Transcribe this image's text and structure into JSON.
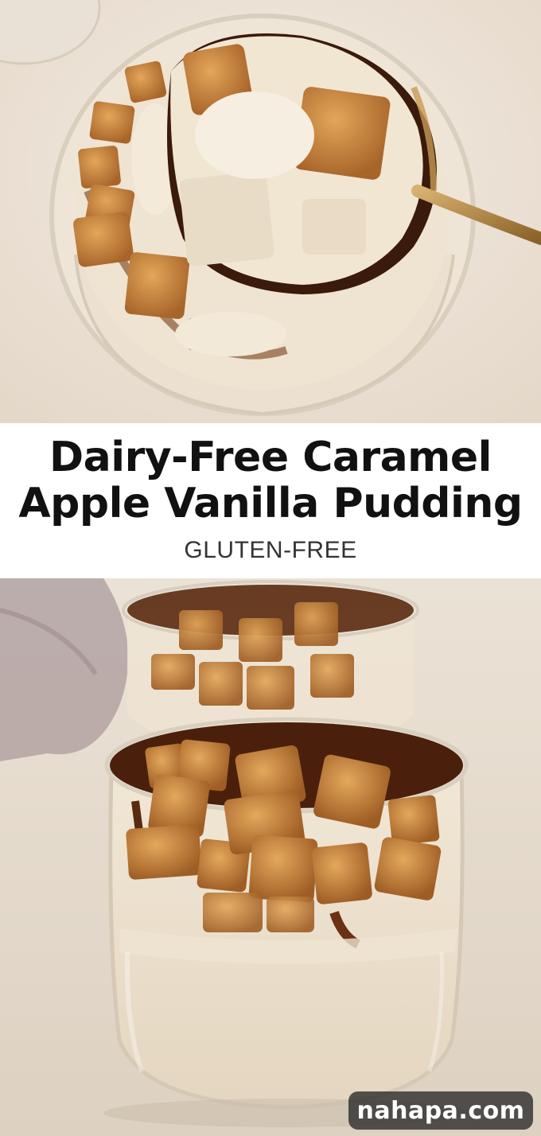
{
  "title": {
    "line1": "Dairy-Free Caramel",
    "line2": "Apple Vanilla Pudding",
    "subtitle": "GLUTEN-FREE"
  },
  "watermark": "nahapa.com",
  "photos": {
    "top": "close-up of a spoonful of vanilla pudding with caramel apples",
    "bottom": "two glasses of vanilla pudding topped with cinnamon caramel apple pieces"
  },
  "colors": {
    "background": "#efe6da",
    "pudding": "#efe3cf",
    "apple": "#c98a3f",
    "caramel": "#5a2a10",
    "spoon": "#b48a4a",
    "title_band": "#ffffff",
    "title_text": "#111111"
  }
}
